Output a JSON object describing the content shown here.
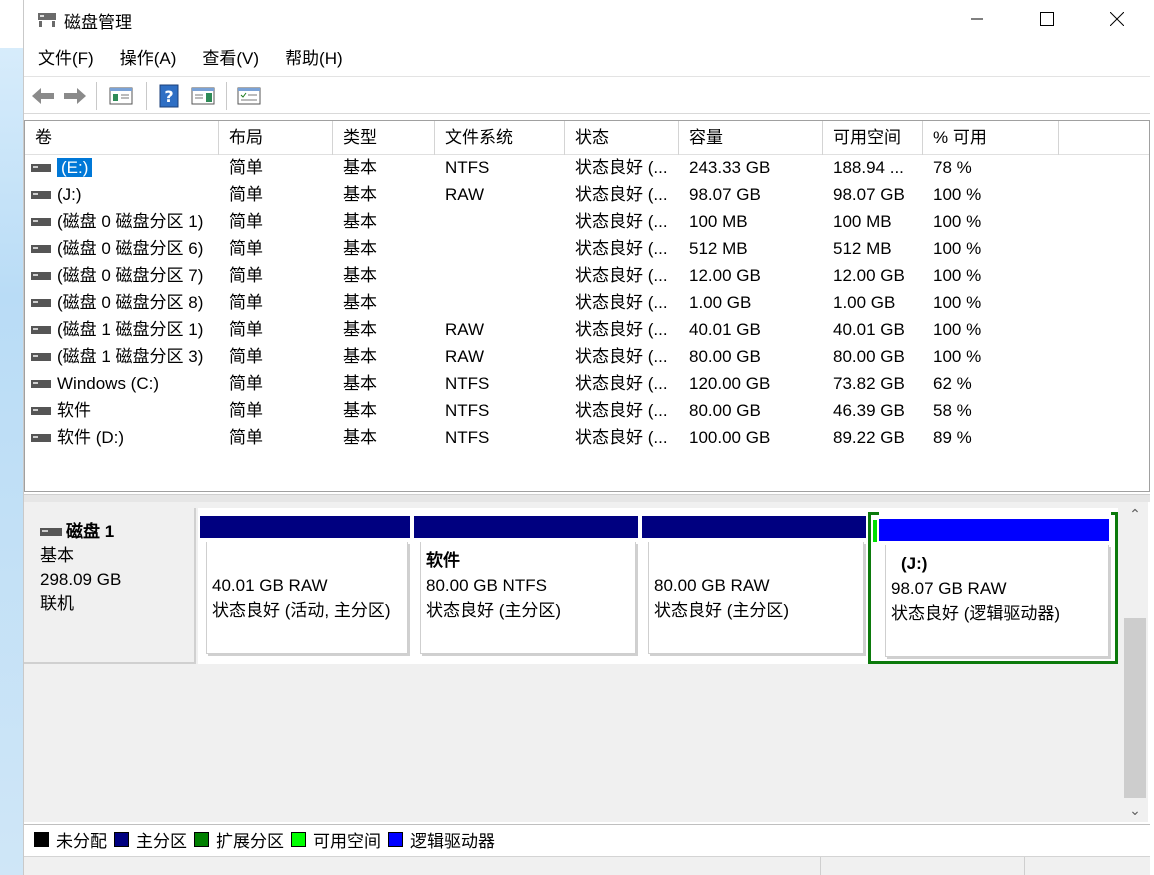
{
  "window": {
    "title": "磁盘管理"
  },
  "menu": [
    "文件(F)",
    "操作(A)",
    "查看(V)",
    "帮助(H)"
  ],
  "columns": [
    "卷",
    "布局",
    "类型",
    "文件系统",
    "状态",
    "容量",
    "可用空间",
    "% 可用"
  ],
  "volumes": [
    {
      "name": "(E:)",
      "layout": "简单",
      "type": "基本",
      "fs": "NTFS",
      "status": "状态良好 (...",
      "capacity": "243.33 GB",
      "free": "188.94 ...",
      "pct": "78 %",
      "selected": true
    },
    {
      "name": "(J:)",
      "layout": "简单",
      "type": "基本",
      "fs": "RAW",
      "status": "状态良好 (...",
      "capacity": "98.07 GB",
      "free": "98.07 GB",
      "pct": "100 %"
    },
    {
      "name": "(磁盘 0 磁盘分区 1)",
      "layout": "简单",
      "type": "基本",
      "fs": "",
      "status": "状态良好 (...",
      "capacity": "100 MB",
      "free": "100 MB",
      "pct": "100 %"
    },
    {
      "name": "(磁盘 0 磁盘分区 6)",
      "layout": "简单",
      "type": "基本",
      "fs": "",
      "status": "状态良好 (...",
      "capacity": "512 MB",
      "free": "512 MB",
      "pct": "100 %"
    },
    {
      "name": "(磁盘 0 磁盘分区 7)",
      "layout": "简单",
      "type": "基本",
      "fs": "",
      "status": "状态良好 (...",
      "capacity": "12.00 GB",
      "free": "12.00 GB",
      "pct": "100 %"
    },
    {
      "name": "(磁盘 0 磁盘分区 8)",
      "layout": "简单",
      "type": "基本",
      "fs": "",
      "status": "状态良好 (...",
      "capacity": "1.00 GB",
      "free": "1.00 GB",
      "pct": "100 %"
    },
    {
      "name": "(磁盘 1 磁盘分区 1)",
      "layout": "简单",
      "type": "基本",
      "fs": "RAW",
      "status": "状态良好 (...",
      "capacity": "40.01 GB",
      "free": "40.01 GB",
      "pct": "100 %"
    },
    {
      "name": "(磁盘 1 磁盘分区 3)",
      "layout": "简单",
      "type": "基本",
      "fs": "RAW",
      "status": "状态良好 (...",
      "capacity": "80.00 GB",
      "free": "80.00 GB",
      "pct": "100 %"
    },
    {
      "name": "Windows (C:)",
      "layout": "简单",
      "type": "基本",
      "fs": "NTFS",
      "status": "状态良好 (...",
      "capacity": "120.00 GB",
      "free": "73.82 GB",
      "pct": "62 %"
    },
    {
      "name": "软件",
      "layout": "简单",
      "type": "基本",
      "fs": "NTFS",
      "status": "状态良好 (...",
      "capacity": "80.00 GB",
      "free": "46.39 GB",
      "pct": "58 %"
    },
    {
      "name": "软件 (D:)",
      "layout": "简单",
      "type": "基本",
      "fs": "NTFS",
      "status": "状态良好 (...",
      "capacity": "100.00 GB",
      "free": "89.22 GB",
      "pct": "89 %"
    }
  ],
  "disk": {
    "name": "磁盘 1",
    "type": "基本",
    "size": "298.09 GB",
    "state": "联机",
    "partitions": [
      {
        "title": "",
        "size": "40.01 GB RAW",
        "status": "状态良好 (活动, 主分区)",
        "kind": "primary"
      },
      {
        "title": "软件",
        "size": "80.00 GB NTFS",
        "status": "状态良好 (主分区)",
        "kind": "primary"
      },
      {
        "title": "",
        "size": "80.00 GB RAW",
        "status": "状态良好 (主分区)",
        "kind": "primary"
      },
      {
        "title": "(J:)",
        "size": "98.07 GB RAW",
        "status": "状态良好 (逻辑驱动器)",
        "kind": "logical"
      }
    ]
  },
  "legend": [
    {
      "label": "未分配",
      "color": "#000000"
    },
    {
      "label": "主分区",
      "color": "#000080"
    },
    {
      "label": "扩展分区",
      "color": "#008000"
    },
    {
      "label": "可用空间",
      "color": "#00ff00"
    },
    {
      "label": "逻辑驱动器",
      "color": "#0000ff"
    }
  ],
  "colors": {
    "primary": "#000080",
    "logical": "#0000ff",
    "extended": "#0b7a0b",
    "selection": "#0078d7"
  }
}
